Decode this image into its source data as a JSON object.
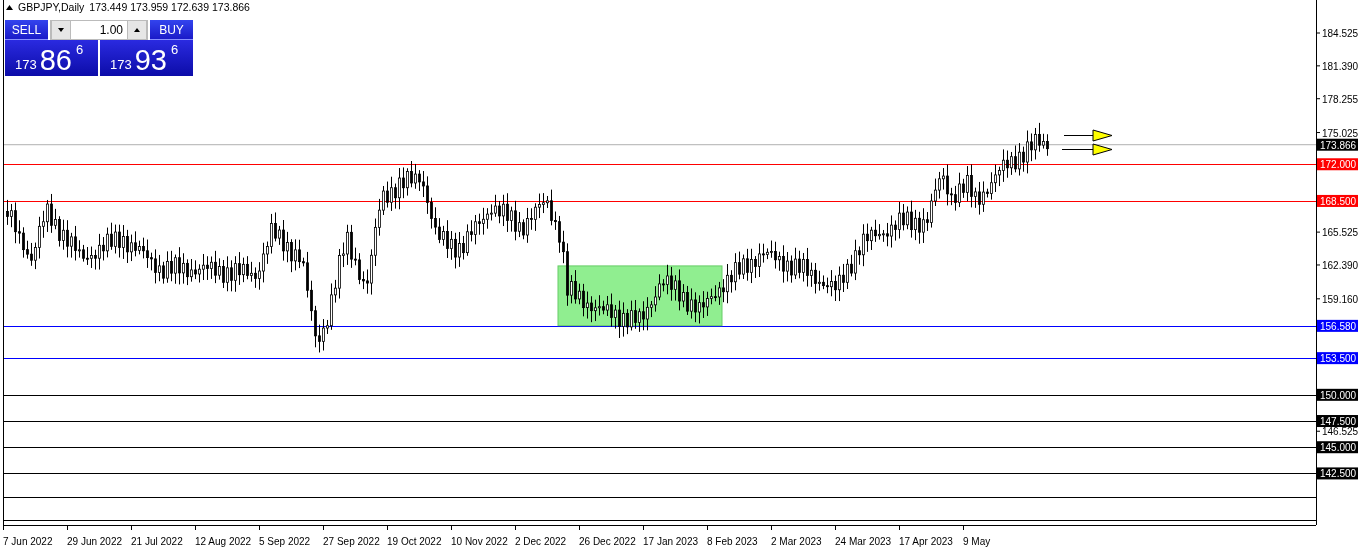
{
  "header": {
    "symbol": "GBPJPY,Daily",
    "ohlc": "173.449 173.959 172.639 173.866"
  },
  "trade_panel": {
    "sell_label": "SELL",
    "buy_label": "BUY",
    "lot": "1.00",
    "sell_quote": {
      "big": "173",
      "main": "86",
      "pip": "6"
    },
    "buy_quote": {
      "big": "173",
      "main": "93",
      "pip": "6"
    }
  },
  "current_price": "173.866",
  "levels": [
    {
      "price": "172.000",
      "color": "#ff0000"
    },
    {
      "price": "168.500",
      "color": "#ff0000"
    },
    {
      "price": "156.580",
      "color": "#0000ff"
    },
    {
      "price": "153.500",
      "color": "#0000ff"
    },
    {
      "price": "150.000",
      "color": "#000000"
    },
    {
      "price": "147.500",
      "color": "#000000"
    },
    {
      "price": "145.000",
      "color": "#000000"
    },
    {
      "price": "142.500",
      "color": "#000000"
    }
  ],
  "price_ticks": [
    "184.525",
    "181.390",
    "178.255",
    "175.025",
    "165.525",
    "162.390",
    "159.160",
    "146.525"
  ],
  "dates": [
    "7 Jun 2022",
    "29 Jun 2022",
    "21 Jul 2022",
    "12 Aug 2022",
    "5 Sep 2022",
    "27 Sep 2022",
    "19 Oct 2022",
    "10 Nov 2022",
    "2 Dec 2022",
    "26 Dec 2022",
    "17 Jan 2023",
    "8 Feb 2023",
    "2 Mar 2023",
    "24 Mar 2023",
    "17 Apr 2023",
    "9 May"
  ]
}
